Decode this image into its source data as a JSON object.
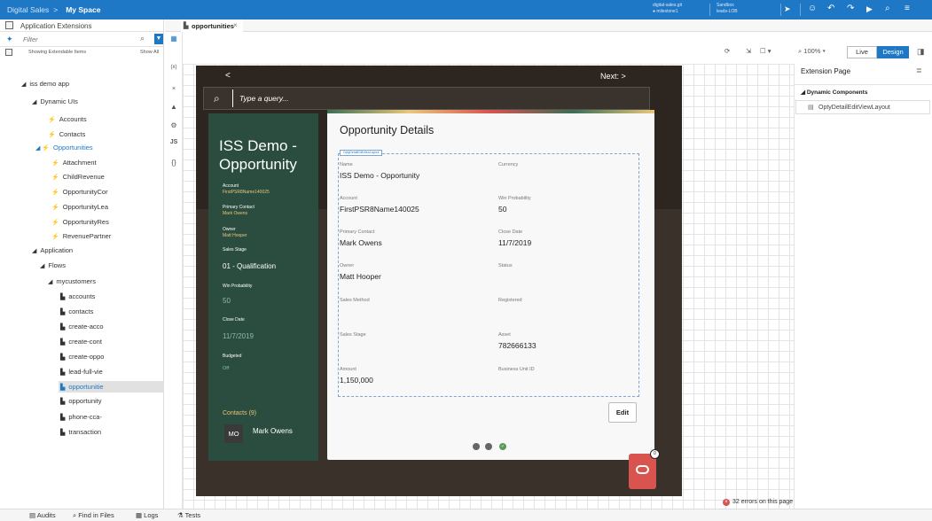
{
  "topbar": {
    "crumb_root": "Digital Sales",
    "crumb_sep": ">",
    "crumb_current": "My Space",
    "status_line1": "digital-sales.git",
    "status_line2": "● milestone1",
    "sandbox_line1": "Sandbox",
    "sandbox_line2": "leads-LOB",
    "icons": [
      "send-icon",
      "smiley-icon",
      "undo-icon",
      "redo-icon",
      "play-icon",
      "search-icon",
      "menu-icon"
    ]
  },
  "left": {
    "title": "Application Extensions",
    "filter_placeholder": "Filter",
    "showing": "Showing Extendable Items",
    "show_all": "Show All",
    "tree": [
      {
        "label": "iss demo app",
        "indent": 0,
        "icon": "◢"
      },
      {
        "label": "Dynamic UIs",
        "indent": 1,
        "icon": "◢"
      },
      {
        "label": "Accounts",
        "indent": 3,
        "icon": "⚡"
      },
      {
        "label": "Contacts",
        "indent": 3,
        "icon": "⚡"
      },
      {
        "label": "Opportunities",
        "indent": 2,
        "icon": "◢ ⚡",
        "blue": true
      },
      {
        "label": "Attachment",
        "indent": 4,
        "icon": "⚡"
      },
      {
        "label": "ChildRevenue",
        "indent": 4,
        "icon": "⚡"
      },
      {
        "label": "OpportunityCor",
        "indent": 4,
        "icon": "⚡"
      },
      {
        "label": "OpportunityLea",
        "indent": 4,
        "icon": "⚡"
      },
      {
        "label": "OpportunityRes",
        "indent": 4,
        "icon": "⚡"
      },
      {
        "label": "RevenuePartner",
        "indent": 4,
        "icon": "⚡"
      },
      {
        "label": "Application",
        "indent": 1,
        "icon": "◢"
      },
      {
        "label": "Flows",
        "indent": 2,
        "icon": "◢"
      },
      {
        "label": "mycustomers",
        "indent": 3,
        "icon": "◢"
      },
      {
        "label": "accounts",
        "indent": 5,
        "icon": "▙"
      },
      {
        "label": "contacts",
        "indent": 5,
        "icon": "▙"
      },
      {
        "label": "create-acco",
        "indent": 5,
        "icon": "▙"
      },
      {
        "label": "create-cont",
        "indent": 5,
        "icon": "▙"
      },
      {
        "label": "create-oppo",
        "indent": 5,
        "icon": "▙"
      },
      {
        "label": "lead-full-vie",
        "indent": 5,
        "icon": "▙"
      },
      {
        "label": "opportunitie",
        "indent": 5,
        "icon": "▙",
        "selected": true
      },
      {
        "label": "opportunity",
        "indent": 5,
        "icon": "▙"
      },
      {
        "label": "phone-cca-",
        "indent": 5,
        "icon": "▙"
      },
      {
        "label": "transaction",
        "indent": 5,
        "icon": "▙"
      }
    ]
  },
  "tab": {
    "label": "opportunities",
    "close": "×"
  },
  "toolbar": {
    "zoom": "100%",
    "live": "Live",
    "design": "Design"
  },
  "device": {
    "back": "<",
    "next": "Next:  >",
    "search_placeholder": "Type a query...",
    "summary": {
      "title": "ISS Demo - Opportunity",
      "account_label": "Account",
      "account_value": "FirstPSR8Name140025",
      "contact_label": "Primary Contact",
      "contact_value": "Mark Owens",
      "owner_label": "Owner",
      "owner_value": "Matt Hooper",
      "stage_label": "Sales Stage",
      "stage_value": "01 - Qualification",
      "winprob_label": "Win Probability",
      "winprob_value": "50",
      "close_label": "Close Date",
      "close_value": "11/7/2019",
      "budgeted_label": "Budgeted",
      "budgeted_value": "Off",
      "contacts_label": "Contacts (9)",
      "avatar": "MO",
      "contact_name": "Mark Owens"
    },
    "card": {
      "title": "Opportunity Details",
      "layout_tag": "OptyDetailEditViewLayout",
      "fields": [
        {
          "label": "Name",
          "value": "ISS Demo - Opportunity"
        },
        {
          "label": "Currency",
          "value": ""
        },
        {
          "label": "Account",
          "value": "FirstPSR8Name140025"
        },
        {
          "label": "Win Probability",
          "value": "50"
        },
        {
          "label": "Primary Contact",
          "value": "Mark Owens"
        },
        {
          "label": "Close Date",
          "value": "11/7/2019"
        },
        {
          "label": "Owner",
          "value": "Matt Hooper"
        },
        {
          "label": "Status",
          "value": ""
        },
        {
          "label": "Sales Method",
          "value": ""
        },
        {
          "label": "Registered",
          "value": ""
        },
        {
          "label": "Sales Stage",
          "value": ""
        },
        {
          "label": "Asset",
          "value": "782666133"
        },
        {
          "label": "Amount",
          "value": "1,150,000"
        },
        {
          "label": "Business Unit ID",
          "value": ""
        }
      ],
      "edit": "Edit"
    },
    "badge": "0"
  },
  "right": {
    "title": "Extension Page",
    "section": "Dynamic Components",
    "item": "OptyDetailEditViewLayout"
  },
  "errors": "32 errors on this page",
  "bottom": {
    "audits": "Audits",
    "find": "Find in Files",
    "logs": "Logs",
    "tests": "Tests"
  },
  "colors": {
    "accent": "#1f78c6",
    "green_panel": "#2a4d3f",
    "gold": "#e9c77b",
    "error": "#d9534f"
  }
}
